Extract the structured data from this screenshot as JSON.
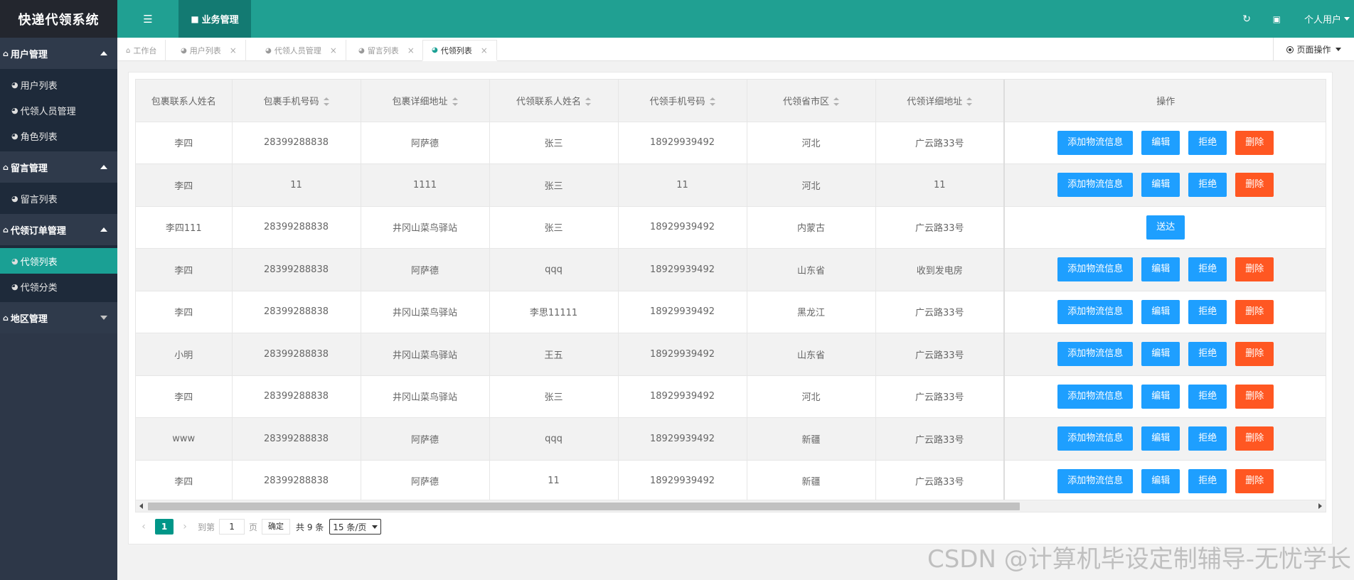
{
  "app": {
    "title": "快递代领系统"
  },
  "sidebar": {
    "groups": [
      {
        "label": "用户管理",
        "items": [
          {
            "label": "用户列表"
          },
          {
            "label": "代领人员管理"
          },
          {
            "label": "角色列表"
          }
        ]
      },
      {
        "label": "留言管理",
        "items": [
          {
            "label": "留言列表"
          }
        ]
      },
      {
        "label": "代领订单管理",
        "items": [
          {
            "label": "代领列表"
          },
          {
            "label": "代领分类"
          }
        ]
      },
      {
        "label": "地区管理",
        "items": []
      }
    ]
  },
  "header": {
    "menu_icon": "list-icon",
    "biz_tab": "业务管理",
    "refresh_icon": "refresh-icon",
    "trash_icon": "trash-icon",
    "user_menu": "个人用户"
  },
  "tabs": [
    {
      "label": "工作台"
    },
    {
      "label": "用户列表"
    },
    {
      "label": "代领人员管理"
    },
    {
      "label": "留言列表"
    },
    {
      "label": "代领列表"
    }
  ],
  "page_ops": {
    "label": "页面操作"
  },
  "table": {
    "columns": [
      "包裹联系人姓名",
      "包裹手机号码",
      "包裹详细地址",
      "代领联系人姓名",
      "代领手机号码",
      "代领省市区",
      "代领详细地址",
      "操作"
    ],
    "rows": [
      {
        "c0": "李四",
        "c1": "28399288838",
        "c2": "阿萨德",
        "c3": "张三",
        "c4": "18929939492",
        "c5": "河北",
        "c6": "广云路33号"
      },
      {
        "c0": "李四",
        "c1": "11",
        "c2": "1111",
        "c3": "张三",
        "c4": "11",
        "c5": "河北",
        "c6": "11"
      },
      {
        "c0": "李四111",
        "c1": "28399288838",
        "c2": "井冈山菜鸟驿站",
        "c3": "张三",
        "c4": "18929939492",
        "c5": "内蒙古",
        "c6": "广云路33号"
      },
      {
        "c0": "李四",
        "c1": "28399288838",
        "c2": "阿萨德",
        "c3": "qqq",
        "c4": "18929939492",
        "c5": "山东省",
        "c6": "收到发电房"
      },
      {
        "c0": "李四",
        "c1": "28399288838",
        "c2": "井冈山菜鸟驿站",
        "c3": "李思11111",
        "c4": "18929939492",
        "c5": "黑龙江",
        "c6": "广云路33号"
      },
      {
        "c0": "小明",
        "c1": "28399288838",
        "c2": "井冈山菜鸟驿站",
        "c3": "王五",
        "c4": "18929939492",
        "c5": "山东省",
        "c6": "广云路33号"
      },
      {
        "c0": "李四",
        "c1": "28399288838",
        "c2": "井冈山菜鸟驿站",
        "c3": "张三",
        "c4": "18929939492",
        "c5": "河北",
        "c6": "广云路33号"
      },
      {
        "c0": "www",
        "c1": "28399288838",
        "c2": "阿萨德",
        "c3": "qqq",
        "c4": "18929939492",
        "c5": "新疆",
        "c6": "广云路33号"
      },
      {
        "c0": "李四",
        "c1": "28399288838",
        "c2": "阿萨德",
        "c3": "11",
        "c4": "18929939492",
        "c5": "新疆",
        "c6": "广云路33号"
      }
    ],
    "actions": {
      "add": "添加物流信息",
      "edit": "编辑",
      "reject": "拒绝",
      "delete": "删除",
      "deliver": "送达"
    },
    "colors": {
      "primary": "#1e9fff",
      "danger": "#ff5722",
      "accent": "#009688"
    }
  },
  "pager": {
    "prev_icon": "chevron-left-icon",
    "current": "1",
    "next_icon": "chevron-right-icon",
    "goto_label": "到第",
    "goto_value": "1",
    "page_unit": "页",
    "confirm": "确定",
    "total": "共 9 条",
    "page_size": "15 条/页"
  },
  "watermark": "CSDN @计算机毕设定制辅导-无忧学长"
}
